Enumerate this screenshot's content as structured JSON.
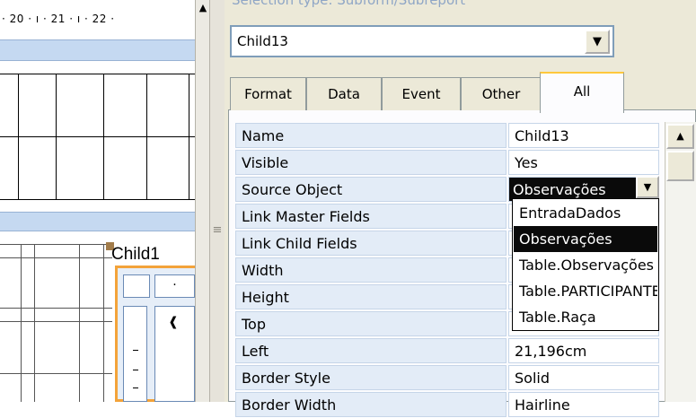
{
  "ruler": {
    "text": "· 20 · ı · 21 · ı · 22 ·"
  },
  "subform": {
    "child_label": "Child1",
    "control_mark": "·",
    "arrow_glyph": "❰"
  },
  "panel": {
    "selection_type": "Selection type: Subform/Subreport",
    "object_selector": {
      "value": "Child13",
      "button_glyph": "▼"
    },
    "tabs": [
      {
        "label": "Format"
      },
      {
        "label": "Data"
      },
      {
        "label": "Event"
      },
      {
        "label": "Other"
      },
      {
        "label": "All",
        "selected": true
      }
    ],
    "properties": [
      {
        "name": "Name",
        "value": "Child13"
      },
      {
        "name": "Visible",
        "value": "Yes"
      },
      {
        "name": "Source Object",
        "value": "Observações"
      },
      {
        "name": "Link Master Fields",
        "value": ""
      },
      {
        "name": "Link Child Fields",
        "value": ""
      },
      {
        "name": "Width",
        "value": ""
      },
      {
        "name": "Height",
        "value": ""
      },
      {
        "name": "Top",
        "value": ""
      },
      {
        "name": "Left",
        "value": "21,196cm"
      },
      {
        "name": "Border Style",
        "value": "Solid"
      },
      {
        "name": "Border Width",
        "value": "Hairline"
      }
    ],
    "dropdown_button_glyph": "▼",
    "dropdown_options": [
      {
        "label": "EntradaDados"
      },
      {
        "label": "Observações",
        "selected": true
      },
      {
        "label": "Table.Observações"
      },
      {
        "label": "Table.PARTICIPANTES"
      },
      {
        "label": "Table.Raça"
      }
    ],
    "scroll_up_glyph": "▲"
  },
  "design_scroll_up_glyph": "▲",
  "splitter_grip": "≡",
  "colors": {
    "section_band": "#c5d9f1",
    "property_name_bg": "#e3ecf7",
    "selection_bg": "#0a0a0a",
    "tab_highlight": "#ffc83c",
    "subform_border": "#f3a33a"
  }
}
